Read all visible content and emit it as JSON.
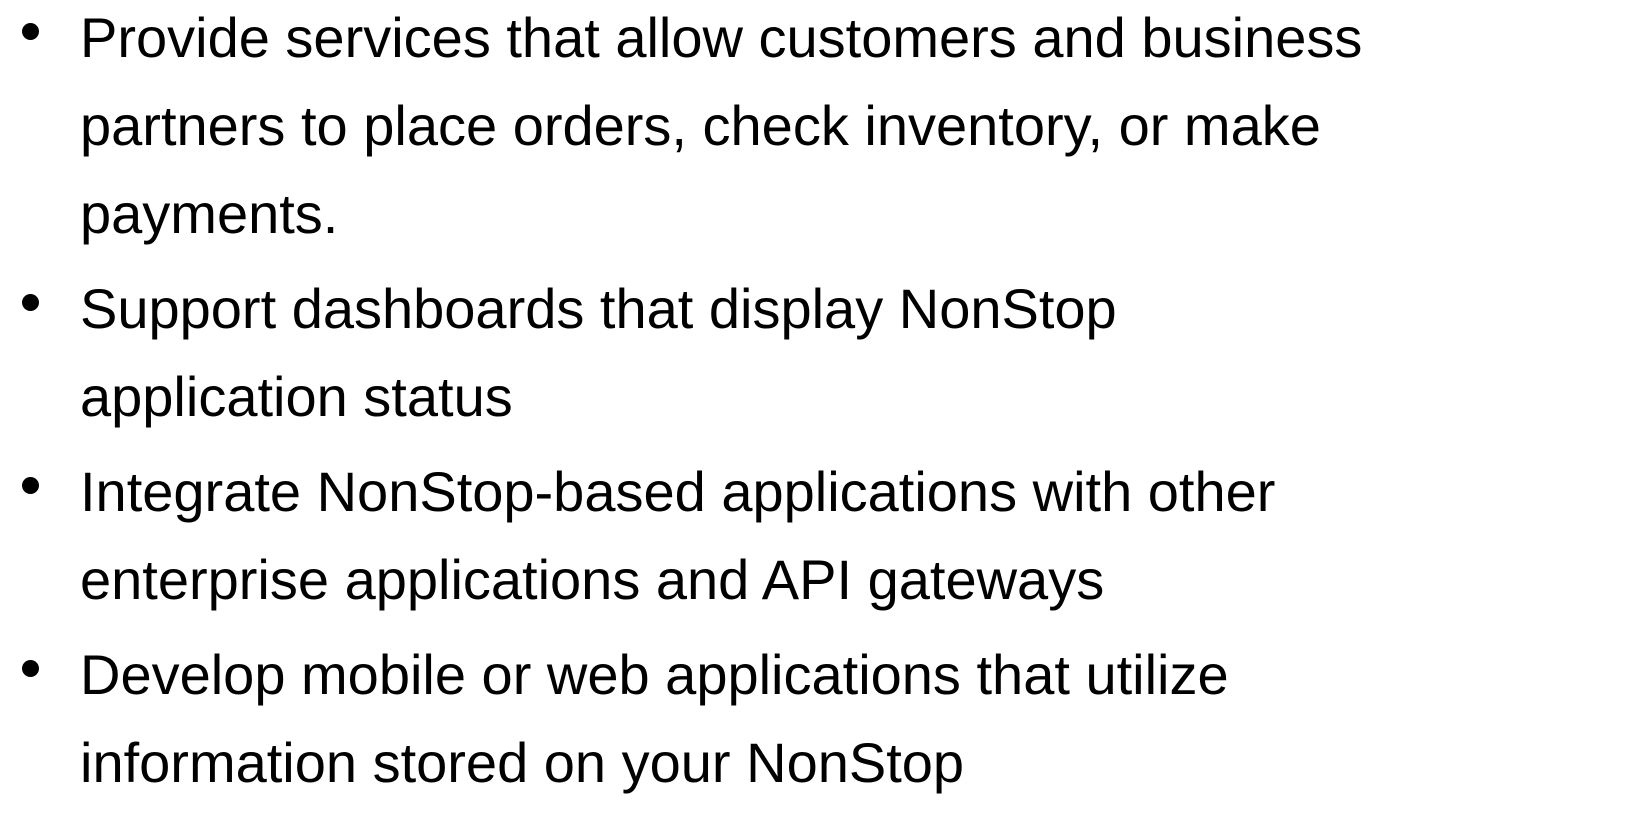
{
  "bullets": [
    {
      "lines": [
        "Provide services that allow customers and business",
        "partners to place orders, check inventory, or make",
        "payments."
      ]
    },
    {
      "lines": [
        "Support dashboards that display NonStop",
        "application status"
      ]
    },
    {
      "lines": [
        "Integrate NonStop-based applications with other",
        "enterprise applications and API gateways"
      ]
    },
    {
      "lines": [
        "Develop mobile or web applications that utilize",
        "information stored on your NonStop"
      ]
    }
  ],
  "colors": {
    "background": "#ffffff",
    "text": "#000000"
  }
}
